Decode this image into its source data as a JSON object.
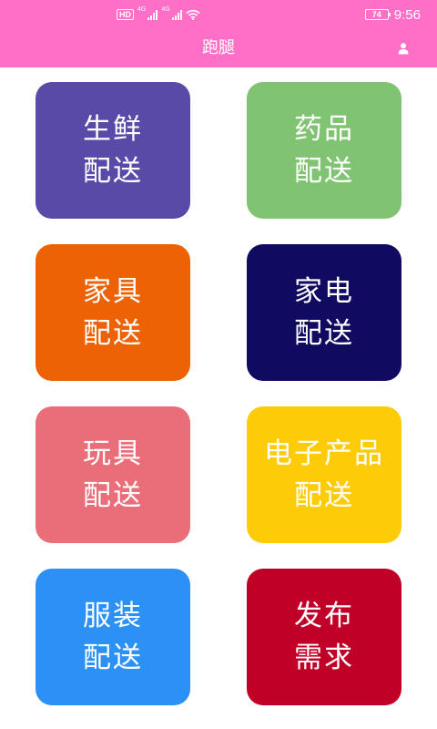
{
  "status_bar": {
    "hd_label": "HD",
    "net_label_1": "4G",
    "net_label_2": "4G",
    "battery": "74",
    "time": "9:56"
  },
  "header": {
    "title": "跑腿",
    "background": "#ff6fc8"
  },
  "tiles": [
    {
      "line1": "生鲜",
      "line2": "配送",
      "color": "#5a4aa8"
    },
    {
      "line1": "药品",
      "line2": "配送",
      "color": "#80c473"
    },
    {
      "line1": "家具",
      "line2": "配送",
      "color": "#ec6205"
    },
    {
      "line1": "家电",
      "line2": "配送",
      "color": "#100a60"
    },
    {
      "line1": "玩具",
      "line2": "配送",
      "color": "#ea6e79"
    },
    {
      "line1": "电子产品",
      "line2": "配送",
      "color": "#fdcb07"
    },
    {
      "line1": "服装",
      "line2": "配送",
      "color": "#2b91f5"
    },
    {
      "line1": "发布",
      "line2": "需求",
      "color": "#c10028"
    }
  ],
  "icons": {
    "profile": "person-icon",
    "wifi": "wifi-icon",
    "signal": "signal-icon",
    "battery": "battery-icon"
  }
}
